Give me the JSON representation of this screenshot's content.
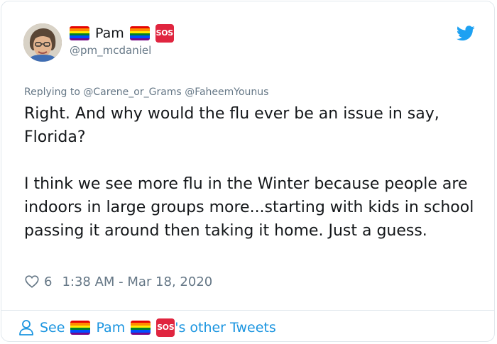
{
  "tweet": {
    "author": {
      "name": "Pam",
      "handle": "@pm_mcdaniel",
      "badge_text": "SOS"
    },
    "replying": {
      "prefix": "Replying to",
      "mentions": [
        "@Carene_or_Grams",
        "@FaheemYounus"
      ]
    },
    "text": "Right. And why would the flu ever be an issue in say, Florida?\n\nI think we see more flu in the Winter because people are indoors in large groups more...starting with kids in school passing it around then taking it home. Just a guess.",
    "likes": "6",
    "timestamp": "1:38 AM - Mar 18, 2020"
  },
  "footer": {
    "see_label": "See",
    "name": "Pam",
    "badge_text": "SOS",
    "suffix": "'s other Tweets"
  },
  "icons": {
    "avatar": "profile-photo",
    "pride_flag": "rainbow-flag-icon",
    "sos": "sos-badge-icon",
    "twitter": "twitter-bird-icon",
    "heart": "heart-icon",
    "person": "person-icon"
  },
  "colors": {
    "link": "#1b95e0",
    "muted": "#657786",
    "text": "#14171a",
    "twitter_blue": "#1da1f2",
    "sos_red": "#e0253f",
    "flag_stripes": [
      "#e40303",
      "#ff8c00",
      "#ffed00",
      "#008026",
      "#004dff",
      "#750787"
    ]
  }
}
